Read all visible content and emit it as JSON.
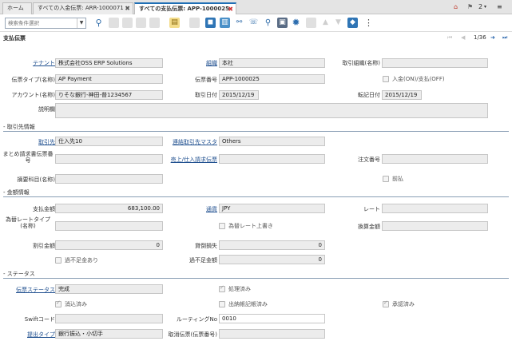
{
  "tabs": [
    {
      "label": "ホーム"
    },
    {
      "label": "すべての入金伝票: ARR-1000071"
    },
    {
      "label": "すべての支払伝票: APP-1000025"
    }
  ],
  "topbar": {
    "count": "2"
  },
  "search": {
    "placeholder": "検索条件選択"
  },
  "page": {
    "title": "支払伝票",
    "record_nav": "1/36"
  },
  "header": {
    "tenant_label": "テナント",
    "tenant_value": "株式会社OSS ERP Solutions",
    "org_label": "組織",
    "org_value": "本社",
    "trx_org_label": "取引組織(名称)",
    "trx_org_value": "",
    "doctype_label": "伝票タイプ(名称)",
    "doctype_value": "AP Payment",
    "docno_label": "伝票番号",
    "docno_value": "APP-1000025",
    "receipt_label": "入金(ON)/支払(OFF)",
    "account_label": "アカウント(名称)",
    "account_value": "りそな銀行-神田-普1234567",
    "trxdate_label": "取引日付",
    "trxdate_value": "2015/12/19",
    "acctdate_label": "転記日付",
    "acctdate_value": "2015/12/19",
    "desc_label": "説明欄",
    "desc_value": ""
  },
  "partner": {
    "section": "- 取引先情報",
    "bp_label": "取引先",
    "bp_value": "仕入先10",
    "bpmaster_label": "連結取引先マスタ",
    "bpmaster_value": "Others",
    "batch_label": "まとめ請求書伝票番号",
    "batch_value": "",
    "invoice_label": "売上/仕入請求伝票",
    "invoice_value": "",
    "order_label": "注文番号",
    "order_value": "",
    "charge_label": "摘要科目(名称)",
    "charge_value": "",
    "prepay_label": "前払"
  },
  "amount": {
    "section": "- 金額情報",
    "pay_label": "支払金額",
    "pay_value": "683,100.00",
    "currency_label": "通貨",
    "currency_value": "JPY",
    "rate_label": "レート",
    "rate_value": "",
    "ratetype_label": "為替レートタイプ(名称)",
    "ratetype_value": "",
    "override_label": "為替レート上書き",
    "convert_label": "換算金額",
    "convert_value": "",
    "discount_label": "割引金額",
    "discount_value": "0",
    "writeoff_label": "貸倒損失",
    "writeoff_value": "0",
    "overunder_label": "過不足金あり",
    "under_label": "過不足金額",
    "under_value": "0"
  },
  "status": {
    "section": "- ステータス",
    "docstatus_label": "伝票ステータス",
    "docstatus_value": "完成",
    "processed_label": "処理済み",
    "reconciled_label": "消込済み",
    "bankstmt_label": "出納帳記帳済み",
    "approved_label": "承認済み",
    "swift_label": "Swiftコード",
    "swift_value": "",
    "routing_label": "ルーティングNo",
    "routing_value": "0010",
    "tender_label": "提出タイプ",
    "tender_value": "銀行振込・小切手",
    "reversal_label": "取消伝票(伝票番号)",
    "reversal_value": ""
  },
  "colors": {
    "accent": "#1f6fb5",
    "link": "#1f4f8f",
    "field_bg": "#ececec"
  },
  "icons": [
    "home-icon",
    "star-icon",
    "menu-icon",
    "search-icon",
    "new-icon",
    "copy-icon",
    "delete-icon",
    "save-icon",
    "undo-icon",
    "refresh-icon",
    "find-icon",
    "attach-icon",
    "chat-icon",
    "zoom-icon",
    "report-icon",
    "settings-icon",
    "print-icon",
    "up-icon",
    "down-icon",
    "tag-icon",
    "more-icon"
  ]
}
